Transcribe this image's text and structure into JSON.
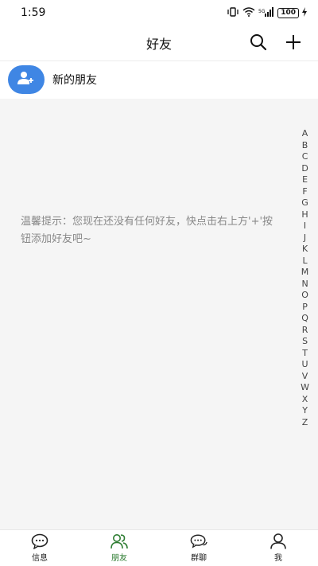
{
  "status_bar": {
    "time": "1:59",
    "battery": "100"
  },
  "header": {
    "title": "好友",
    "search_icon": "search-icon",
    "add_icon": "plus-icon"
  },
  "new_friend": {
    "label": "新的朋友",
    "icon": "add-user-icon"
  },
  "content": {
    "hint": "温馨提示：您现在还没有任何好友，快点击右上方'+'按钮添加好友吧~"
  },
  "alpha_index": [
    "A",
    "B",
    "C",
    "D",
    "E",
    "F",
    "G",
    "H",
    "I",
    "J",
    "K",
    "L",
    "M",
    "N",
    "O",
    "P",
    "Q",
    "R",
    "S",
    "T",
    "U",
    "V",
    "W",
    "X",
    "Y",
    "Z"
  ],
  "bottom_nav": {
    "items": [
      {
        "label": "信息",
        "icon": "chat-bubble-icon",
        "active": false
      },
      {
        "label": "朋友",
        "icon": "friends-icon",
        "active": true
      },
      {
        "label": "群聊",
        "icon": "group-chat-icon",
        "active": false
      },
      {
        "label": "我",
        "icon": "person-icon",
        "active": false
      }
    ]
  },
  "colors": {
    "accent": "#3f86e4",
    "active_tab": "#2e7d32",
    "content_bg": "#f5f5f5",
    "hint_text": "#888888"
  }
}
